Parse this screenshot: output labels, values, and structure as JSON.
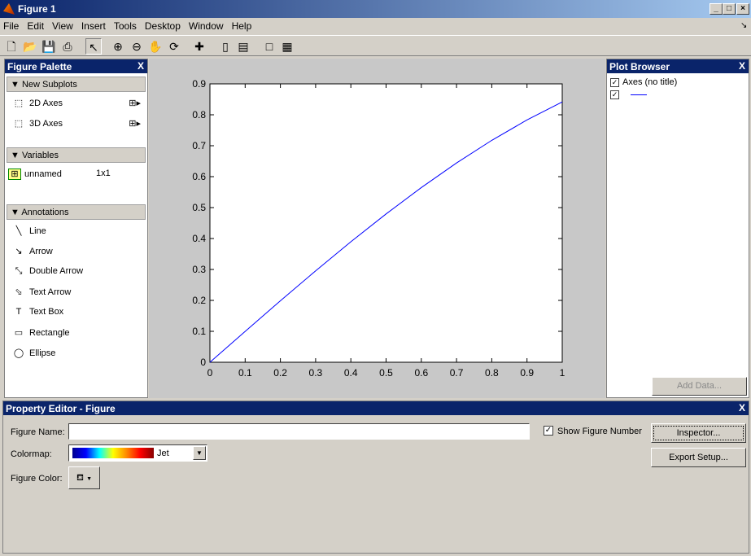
{
  "window": {
    "title": "Figure 1"
  },
  "menu": [
    "File",
    "Edit",
    "View",
    "Insert",
    "Tools",
    "Desktop",
    "Window",
    "Help"
  ],
  "toolbar": [
    "new-file-icon",
    "open-icon",
    "save-icon",
    "print-icon",
    "select-arrow-icon",
    "zoom-in-icon",
    "zoom-out-icon",
    "pan-hand-icon",
    "rotate-3d-icon",
    "data-cursor-icon",
    "colorbar-icon",
    "legend-icon",
    "hide-plot-tools-icon",
    "show-plot-tools-icon"
  ],
  "palette": {
    "title": "Figure Palette",
    "close": "X",
    "new_subplots": "New Subplots",
    "axes2d": "2D Axes",
    "axes3d": "3D Axes",
    "variables": "Variables",
    "var_name": "unnamed",
    "var_size": "1x1",
    "annotations": "Annotations",
    "annotation_items": [
      "Line",
      "Arrow",
      "Double Arrow",
      "Text Arrow",
      "Text Box",
      "Rectangle",
      "Ellipse"
    ]
  },
  "browser": {
    "title": "Plot Browser",
    "close": "X",
    "axes_label": "Axes (no title)",
    "add_data": "Add Data..."
  },
  "property_editor": {
    "title": "Property Editor - Figure",
    "close": "X",
    "figure_name_label": "Figure Name:",
    "figure_name_value": "",
    "show_number": "Show Figure Number",
    "inspector": "Inspector...",
    "export": "Export Setup...",
    "colormap_label": "Colormap:",
    "colormap_value": "Jet",
    "figure_color_label": "Figure Color:"
  },
  "chart_data": {
    "type": "line",
    "xlim": [
      0,
      1
    ],
    "ylim": [
      0,
      0.9
    ],
    "xticks": [
      "0",
      "0.1",
      "0.2",
      "0.3",
      "0.4",
      "0.5",
      "0.6",
      "0.7",
      "0.8",
      "0.9",
      "1"
    ],
    "yticks": [
      "0",
      "0.1",
      "0.2",
      "0.3",
      "0.4",
      "0.5",
      "0.6",
      "0.7",
      "0.8",
      "0.9"
    ],
    "x": [
      0,
      0.1,
      0.2,
      0.3,
      0.4,
      0.5,
      0.6,
      0.7,
      0.8,
      0.9,
      1
    ],
    "y": [
      0,
      0.0998,
      0.1987,
      0.2955,
      0.3894,
      0.4794,
      0.5646,
      0.6442,
      0.7174,
      0.7833,
      0.8415
    ],
    "color": "#0000ff"
  }
}
